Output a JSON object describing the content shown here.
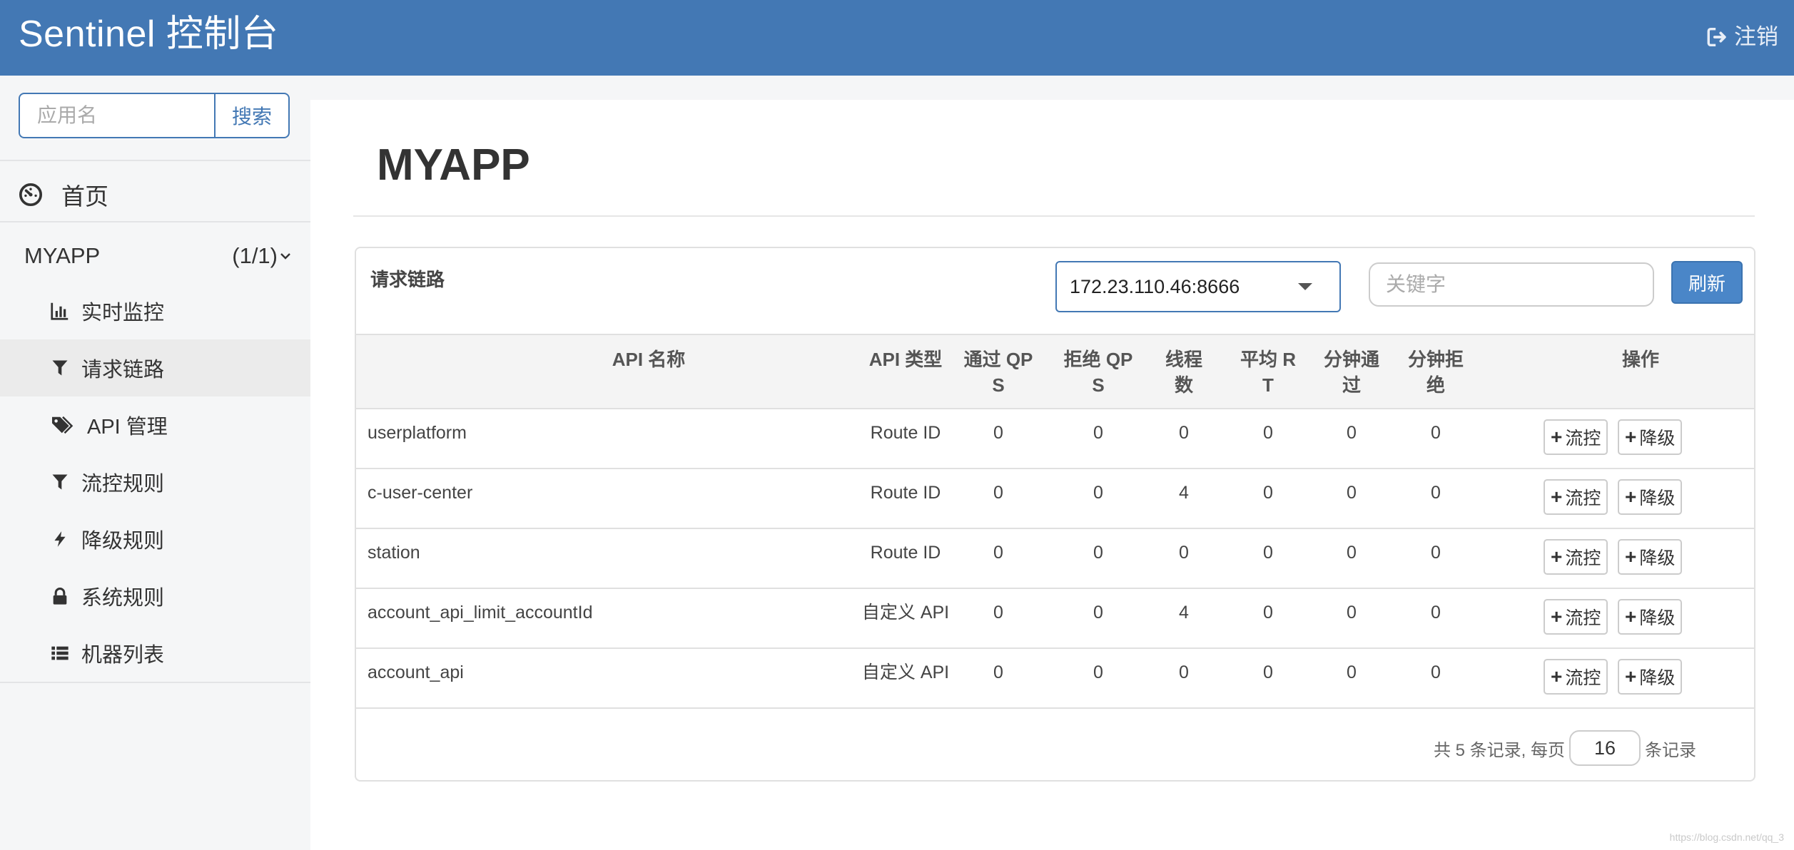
{
  "header": {
    "brand": "Sentinel 控制台",
    "logout_label": "注销"
  },
  "sidebar": {
    "search": {
      "placeholder": "应用名",
      "button_label": "搜索"
    },
    "home_label": "首页",
    "app": {
      "name": "MYAPP",
      "count": "(1/1)"
    },
    "items": [
      {
        "label": "实时监控",
        "icon": "bar-chart-icon"
      },
      {
        "label": "请求链路",
        "icon": "filter-icon"
      },
      {
        "label": "API 管理",
        "icon": "tags-icon"
      },
      {
        "label": "流控规则",
        "icon": "filter-icon"
      },
      {
        "label": "降级规则",
        "icon": "flash-icon"
      },
      {
        "label": "系统规则",
        "icon": "lock-icon"
      },
      {
        "label": "机器列表",
        "icon": "list-icon"
      }
    ],
    "active_index": 1
  },
  "main": {
    "title": "MYAPP",
    "panel": {
      "title": "请求链路",
      "machine_selected": "172.23.110.46:8666",
      "keyword_placeholder": "关键字",
      "refresh_label": "刷新",
      "columns": [
        "API 名称",
        "API 类型",
        "通过 QP\nS",
        "拒绝 QP\nS",
        "线程\n数",
        "平均 R\nT",
        "分钟通\n过",
        "分钟拒\n绝",
        "操作"
      ],
      "rows": [
        {
          "name": "userplatform",
          "type": "Route ID",
          "pass_qps": "0",
          "block_qps": "0",
          "threads": "0",
          "avg_rt": "0",
          "min_pass": "0",
          "min_block": "0"
        },
        {
          "name": "c-user-center",
          "type": "Route ID",
          "pass_qps": "0",
          "block_qps": "0",
          "threads": "4",
          "avg_rt": "0",
          "min_pass": "0",
          "min_block": "0"
        },
        {
          "name": "station",
          "type": "Route ID",
          "pass_qps": "0",
          "block_qps": "0",
          "threads": "0",
          "avg_rt": "0",
          "min_pass": "0",
          "min_block": "0"
        },
        {
          "name": "account_api_limit_accountId",
          "type": "自定义 API",
          "pass_qps": "0",
          "block_qps": "0",
          "threads": "4",
          "avg_rt": "0",
          "min_pass": "0",
          "min_block": "0"
        },
        {
          "name": "account_api",
          "type": "自定义 API",
          "pass_qps": "0",
          "block_qps": "0",
          "threads": "0",
          "avg_rt": "0",
          "min_pass": "0",
          "min_block": "0"
        }
      ],
      "flow_btn_label": "流控",
      "degrade_btn_label": "降级",
      "pager": {
        "prefix": "共 5 条记录, 每页",
        "page_size": "16",
        "suffix": "条记录"
      }
    }
  },
  "watermark": "https://blog.csdn.net/qq_3",
  "colors": {
    "header_bg": "#4378b4",
    "primary": "#4a86c8",
    "active_item_bg": "#ebebeb"
  }
}
